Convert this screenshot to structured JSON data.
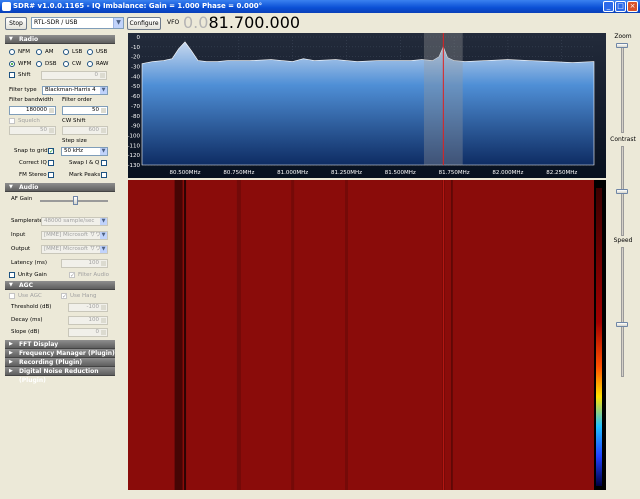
{
  "window": {
    "title": "SDR# v1.0.0.1165 - IQ Imbalance: Gain = 1.000 Phase = 0.000°",
    "minimize": "_",
    "maximize": "□",
    "close": "×"
  },
  "toolbar": {
    "stop_label": "Stop",
    "device": "RTL-SDR / USB",
    "configure_label": "Configure",
    "vfo_label": "VFO",
    "vfo_leading": "0.0",
    "vfo_value": "81.700.000"
  },
  "radio": {
    "header": "Radio",
    "modes": [
      {
        "label": "NFM",
        "selected": false
      },
      {
        "label": "AM",
        "selected": false
      },
      {
        "label": "LSB",
        "selected": false
      },
      {
        "label": "USB",
        "selected": false
      },
      {
        "label": "WFM",
        "selected": true
      },
      {
        "label": "DSB",
        "selected": false
      },
      {
        "label": "CW",
        "selected": false
      },
      {
        "label": "RAW",
        "selected": false
      }
    ],
    "shift_label": "Shift",
    "shift_value": "0",
    "filter_type_label": "Filter type",
    "filter_type_value": "Blackman-Harris 4",
    "filter_bandwidth_label": "Filter bandwidth",
    "filter_bandwidth_value": "180000",
    "filter_order_label": "Filter order",
    "filter_order_value": "50",
    "squelch_label": "Squelch",
    "squelch_value": "50",
    "cw_shift_label": "CW Shift",
    "cw_shift_value": "600",
    "step_size_label": "Step size",
    "step_size_value": "50 kHz",
    "snap_label": "Snap to grid",
    "correct_iq_label": "Correct IQ",
    "swap_iq_label": "Swap I & Q",
    "fm_stereo_label": "FM Stereo",
    "mark_peaks_label": "Mark Peaks"
  },
  "audio": {
    "header": "Audio",
    "af_gain_label": "AF Gain",
    "af_gain_level": 0.55,
    "samplerate_label": "Samplerate",
    "samplerate_value": "48000 sample/sec",
    "input_label": "Input",
    "input_value": "[MME] Microsoft サウ",
    "output_label": "Output",
    "output_value": "[MME] Microsoft サウ",
    "latency_label": "Latency (ms)",
    "latency_value": "100",
    "unity_gain_label": "Unity Gain",
    "filter_audio_label": "Filter Audio"
  },
  "agc": {
    "header": "AGC",
    "use_agc_label": "Use AGC",
    "use_hang_label": "Use Hang",
    "threshold_label": "Threshold (dB)",
    "threshold_value": "-100",
    "decay_label": "Decay (ms)",
    "decay_value": "100",
    "slope_label": "Slope (dB)",
    "slope_value": "0"
  },
  "collapsed_sections": [
    "FFT Display",
    "Frequency Manager (Plugin)",
    "Recording (Plugin)",
    "Digital Noise Reduction (Plugin)"
  ],
  "side_sliders": {
    "zoom_label": "Zoom",
    "contrast_label": "Contrast",
    "speed_label": "Speed",
    "zoom_level": 0.0,
    "contrast_level": 0.5,
    "speed_level": 0.6
  },
  "colors": {
    "spectrum_bg_top": "#1c2f4d",
    "spectrum_fill": "#2f73c0",
    "waterfall_bg": "#8a0c0a",
    "vfo_line": "#e02020",
    "filter_band": "#808080"
  },
  "chart_data": {
    "type": "area",
    "ylabel": "dB",
    "ylim": [
      -130,
      0
    ],
    "y_ticks": [
      "0",
      "-10",
      "-20",
      "-30",
      "-40",
      "-50",
      "-60",
      "-70",
      "-80",
      "-90",
      "-100",
      "-110",
      "-120",
      "-130"
    ],
    "xlim": [
      80.3,
      82.4
    ],
    "x_ticks": [
      "80.500MHz",
      "80.750MHz",
      "81.000MHz",
      "81.250MHz",
      "81.500MHz",
      "81.750MHz",
      "82.000MHz",
      "82.250MHz"
    ],
    "x_tick_values": [
      80.5,
      80.75,
      81.0,
      81.25,
      81.5,
      81.75,
      82.0,
      82.25
    ],
    "vfo_mhz": 81.7,
    "filter_mhz": [
      81.61,
      81.79
    ],
    "series": [
      {
        "x": [
          80.3,
          80.35,
          80.4,
          80.44,
          80.47,
          80.5,
          80.53,
          80.56,
          80.6,
          80.65,
          80.7,
          80.8,
          80.9,
          81.0,
          81.05,
          81.1,
          81.2,
          81.3,
          81.4,
          81.5,
          81.55,
          81.6,
          81.65,
          81.68,
          81.7,
          81.72,
          81.75,
          81.8,
          81.9,
          82.0,
          82.1,
          82.2,
          82.3,
          82.4
        ],
        "values": [
          -27,
          -25,
          -24,
          -22,
          -12,
          -5,
          -14,
          -24,
          -25,
          -25,
          -24,
          -24,
          -23,
          -25,
          -22,
          -24,
          -23,
          -25,
          -24,
          -24,
          -24,
          -23,
          -24,
          -20,
          -10,
          -21,
          -24,
          -25,
          -24,
          -23,
          -24,
          -25,
          -26,
          -25
        ]
      }
    ]
  }
}
